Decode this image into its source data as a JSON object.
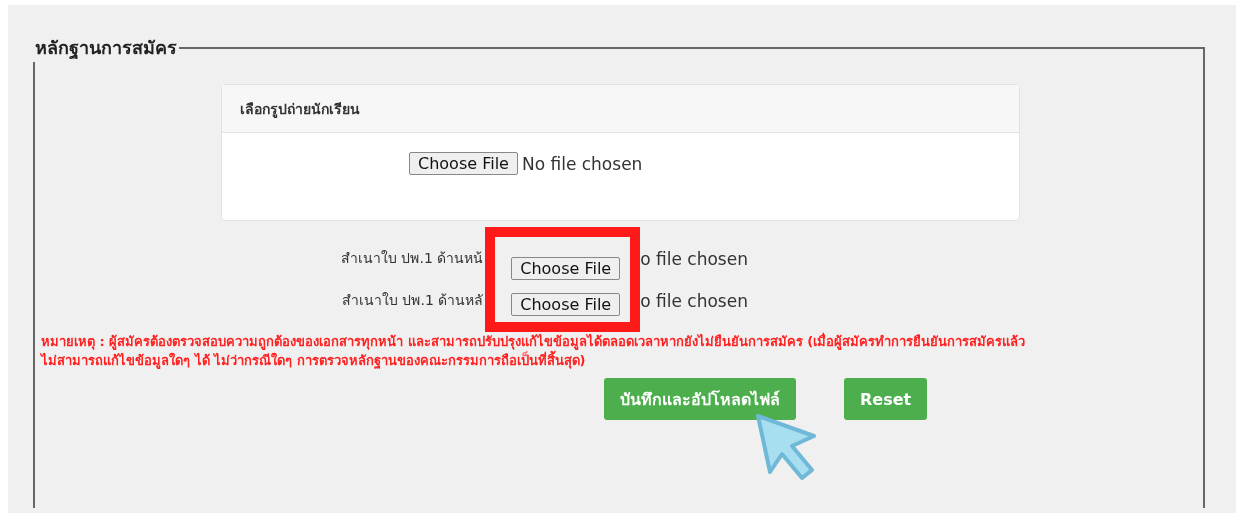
{
  "section": {
    "legend": "หลักฐานการสมัคร"
  },
  "photo_card": {
    "title": "เลือกรูปถ่ายนักเรียน",
    "button": "Choose File",
    "status": "No file chosen"
  },
  "uploads": {
    "highlighted": true,
    "rows": [
      {
        "label": "สำเนาใบ ปพ.1 ด้านหน้",
        "button": "Choose File",
        "status": "o file chosen"
      },
      {
        "label": "สำเนาใบ ปพ.1 ด้านหลั",
        "button": "Choose File",
        "status": "o file chosen"
      }
    ]
  },
  "note": "หมายเหตุ : ผู้สมัครต้องตรวจสอบความถูกต้องของเอกสารทุกหน้า   และสามารถปรับปรุงแก้ไขข้อมูลได้ตลอดเวลาหากยังไม่ยืนยันการสมัคร (เมื่อผู้สมัครทำการยืนยันการสมัครแล้ว ไม่สามารถแก้ไขข้อมูลใดๆ ได้ ไม่ว่ากรณีใดๆ การตรวจหลักฐานของคณะกรรมการถือเป็นที่สิ้นสุด)",
  "buttons": [
    "บันทึกและอัปโหลดไฟล์",
    "Reset"
  ],
  "cursor_shown": true
}
